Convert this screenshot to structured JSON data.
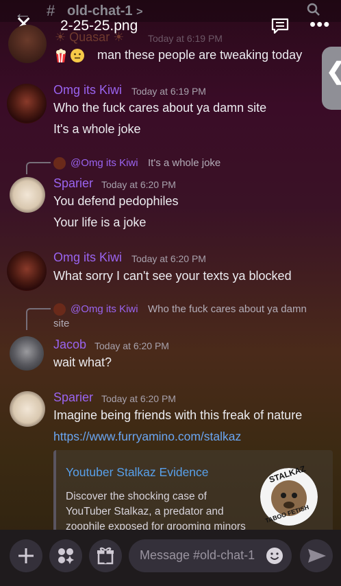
{
  "background_app": {
    "channel_title": "old-chat-1",
    "channel_chevron": ">"
  },
  "viewer": {
    "file_name": "2-25-25.png",
    "close_icon": "close-icon",
    "comment_icon": "comment-icon",
    "more_icon": "more-dots-icon",
    "handle_chevron": "❮"
  },
  "messages": [
    {
      "user": "Quasar",
      "time": "Today at 6:19 PM",
      "lines": [
        "man  these people are tweaking today"
      ]
    },
    {
      "user": "Omg its Kiwi",
      "time": "Today at 6:19 PM",
      "lines": [
        "Who the fuck cares about ya damn site",
        "It's a whole joke"
      ]
    },
    {
      "reply_to": {
        "user": "@Omg its Kiwi",
        "text": "It's a whole joke"
      },
      "user": "Sparier",
      "time": "Today at 6:20 PM",
      "lines": [
        "You defend pedophiles",
        "Your life is a joke"
      ]
    },
    {
      "user": "Omg its Kiwi",
      "time": "Today at 6:20 PM",
      "lines": [
        "What sorry I can't see your texts ya blocked"
      ]
    },
    {
      "reply_to": {
        "user": "@Omg its Kiwi",
        "text": "Who the fuck cares about ya damn",
        "text_cont": "site"
      },
      "user": "Jacob",
      "time": "Today at 6:20 PM",
      "lines": [
        "wait what?"
      ]
    },
    {
      "user": "Sparier",
      "time": "Today at 6:20 PM",
      "lines": [
        "Imagine being friends with this freak of nature"
      ],
      "link": "https://www.furryamino.com/stalkaz",
      "embed": {
        "title": "Youtuber Stalkaz Evidence",
        "desc": "Discover the shocking case of YouTuber Stalkaz, a predator and zoophile exposed for grooming minors",
        "thumb_top": "STALKAZ",
        "thumb_bottom": "TABOO FETISH"
      }
    }
  ],
  "composer": {
    "placeholder": "Message #old-chat-1",
    "icons": [
      "plus-icon",
      "apps-icon",
      "gift-icon",
      "emoji-icon",
      "send-icon"
    ]
  },
  "colors": {
    "username": "#9a64f0",
    "link": "#6aa6f2",
    "embed_title": "#58a0ea"
  }
}
